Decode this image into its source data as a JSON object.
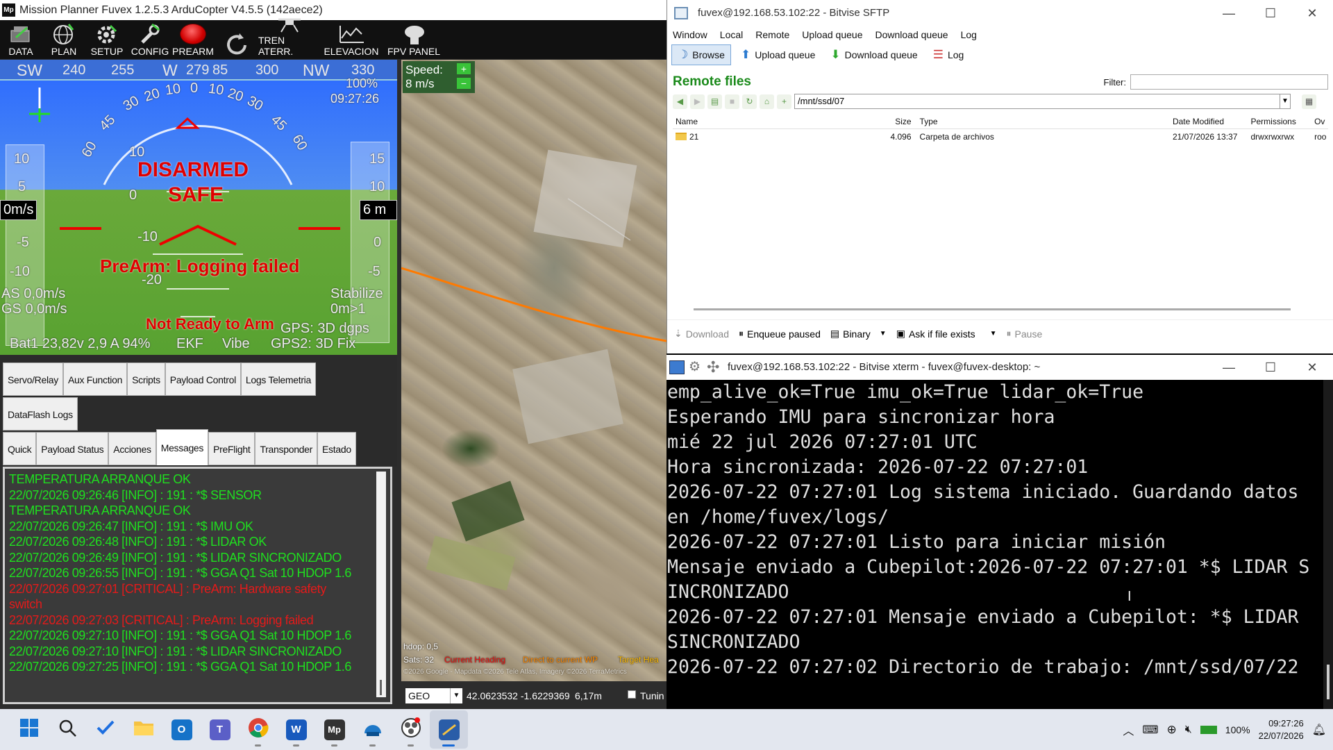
{
  "mp": {
    "title": "Mission Planner Fuvex 1.2.5.3 ArduCopter V4.5.5 (142aece2)",
    "app_icon_text": "Mp",
    "toolbar": [
      {
        "label": "DATA",
        "icon": "data-icon"
      },
      {
        "label": "PLAN",
        "icon": "globe-icon"
      },
      {
        "label": "SETUP",
        "icon": "gear-icon"
      },
      {
        "label": "CONFIG",
        "icon": "wrench-icon"
      },
      {
        "label": "PREARM",
        "icon": "red-button-icon"
      },
      {
        "label": "",
        "icon": "refresh-icon"
      },
      {
        "label": "TREN ATERR.",
        "icon": "drone-icon"
      },
      {
        "label": "ELEVACION",
        "icon": "chart-icon"
      },
      {
        "label": "FPV PANEL",
        "icon": "fpv-icon"
      }
    ],
    "hud": {
      "compass": [
        "SW",
        "240",
        "255",
        "W",
        "279",
        "85",
        "300",
        "NW",
        "330"
      ],
      "pitch_labels": [
        "10",
        "0",
        "-10",
        "-20"
      ],
      "roll_labels": [
        "30",
        "20",
        "10",
        "0",
        "10",
        "20",
        "30",
        "45",
        "45",
        "60",
        "60"
      ],
      "disarmed": "DISARMED",
      "safe": "SAFE",
      "prearm_msg": "PreArm: Logging failed",
      "not_ready": "Not Ready to Arm",
      "gps1": "GPS: 3D dgps",
      "gps2": "GPS2: 3D Fix",
      "airspeed": "AS 0,0m/s",
      "groundspeed": "GS 0,0m/s",
      "speed_box": "0m/s",
      "alt_box": "6 m",
      "mode": "Stabilize",
      "wp": "0m>1",
      "battery": "Bat1 23,82v 2,9 A 94%",
      "ekf": "EKF",
      "vibe": "Vibe",
      "link": "100%",
      "time": "09:27:26",
      "speed_scale": [
        "10",
        "5",
        "-5",
        "-10"
      ],
      "alt_scale": [
        "15",
        "10",
        "0",
        "-5"
      ],
      "colors": {
        "sky": "#2a68ff",
        "ground": "#58a231",
        "warning": "#e00000"
      }
    },
    "tabs_row1": [
      "Servo/Relay",
      "Aux Function",
      "Scripts",
      "Payload Control",
      "Logs Telemetria"
    ],
    "tabs_row2": [
      "DataFlash Logs"
    ],
    "tabs_row3": [
      "Quick",
      "Payload Status",
      "Acciones",
      "Messages",
      "PreFlight",
      "Transponder",
      "Estado"
    ],
    "active_tab": "Messages",
    "messages": [
      {
        "text": "TEMPERATURA ARRANQUE OK",
        "level": "ok"
      },
      {
        "text": "22/07/2026 09:26:46 [INFO] : 191 : *$ SENSOR",
        "level": "ok"
      },
      {
        "text": "TEMPERATURA ARRANQUE OK",
        "level": "ok"
      },
      {
        "text": "22/07/2026 09:26:47 [INFO] : 191 : *$ IMU OK",
        "level": "ok"
      },
      {
        "text": "22/07/2026 09:26:48 [INFO] : 191 : *$ LIDAR OK",
        "level": "ok"
      },
      {
        "text": "22/07/2026 09:26:49 [INFO] : 191 : *$ LIDAR SINCRONIZADO",
        "level": "ok"
      },
      {
        "text": "22/07/2026 09:26:55 [INFO] : 191 : *$ GGA Q1 Sat 10 HDOP 1.6",
        "level": "ok"
      },
      {
        "text": "22/07/2026 09:27:01 [CRITICAL] : PreArm: Hardware safety",
        "level": "err"
      },
      {
        "text": "switch",
        "level": "err"
      },
      {
        "text": "22/07/2026 09:27:03 [CRITICAL] : PreArm: Logging failed",
        "level": "err"
      },
      {
        "text": "22/07/2026 09:27:10 [INFO] : 191 : *$ GGA Q1 Sat 10 HDOP 1.6",
        "level": "ok"
      },
      {
        "text": "22/07/2026 09:27:10 [INFO] : 191 : *$ LIDAR SINCRONIZADO",
        "level": "ok"
      },
      {
        "text": "22/07/2026 09:27:25 [INFO] : 191 : *$ GGA Q1 Sat 10 HDOP 1.6",
        "level": "ok"
      }
    ],
    "map": {
      "speed_label": "Speed:",
      "speed_value": "8 m/s",
      "hdop": "hdop: 0,5",
      "sats": "Sats: 32",
      "legend_current_heading": "Current Heading",
      "legend_direct_wp": "Direct to current WP",
      "legend_target": "Target Hea",
      "copyright": "©2026 Google - Mapdata ©2026 Tele Atlas, Imagery ©2026 TerraMetrics",
      "coord_mode": "GEO",
      "coords": "42.0623532 -1.6229369",
      "alt": "6,17m",
      "tuning_label": "Tunin"
    }
  },
  "sftp": {
    "title": "fuvex@192.168.53.102:22 - Bitvise SFTP",
    "menu": [
      "Window",
      "Local",
      "Remote",
      "Upload queue",
      "Download queue",
      "Log"
    ],
    "toolbar": [
      {
        "label": "Browse",
        "icon": "browse-icon"
      },
      {
        "label": "Upload queue",
        "icon": "upload-icon"
      },
      {
        "label": "Download queue",
        "icon": "download-icon"
      },
      {
        "label": "Log",
        "icon": "log-icon"
      }
    ],
    "remote_title": "Remote files",
    "filter_label": "Filter:",
    "filter_value": "",
    "path": "/mnt/ssd/07",
    "columns": [
      "Name",
      "Size",
      "Type",
      "Date Modified",
      "Permissions",
      "Ov"
    ],
    "files": [
      {
        "name": "21",
        "size": "4.096",
        "type": "Carpeta de archivos",
        "date": "21/07/2026 13:37",
        "perm": "drwxrwxrwx",
        "owner": "roo"
      }
    ],
    "bottom": {
      "download": "Download",
      "enqueue": "Enqueue paused",
      "binary": "Binary",
      "ask": "Ask if file exists",
      "pause": "Pause"
    }
  },
  "xterm": {
    "title": "fuvex@192.168.53.102:22 - Bitvise xterm - fuvex@fuvex-desktop: ~",
    "lines": [
      "emp_alive_ok=True imu_ok=True lidar_ok=True",
      "Esperando IMU para sincronizar hora",
      "mié 22 jul 2026 07:27:01 UTC",
      "Hora sincronizada: 2026-07-22 07:27:01",
      "2026-07-22 07:27:01 Log sistema iniciado. Guardando datos",
      "en /home/fuvex/logs/",
      "2026-07-22 07:27:01 Listo para iniciar misión",
      "Mensaje enviado a Cubepilot:2026-07-22 07:27:01 *$ LIDAR S",
      "INCRONIZADO",
      "2026-07-22 07:27:01 Mensaje enviado a Cubepilot: *$ LIDAR",
      "SINCRONIZADO",
      "2026-07-22 07:27:02 Directorio de trabajo: /mnt/ssd/07/22"
    ]
  },
  "taskbar": {
    "apps": [
      {
        "name": "start",
        "icon": "windows-icon"
      },
      {
        "name": "search",
        "icon": "search-icon"
      },
      {
        "name": "todo",
        "icon": "checkmark-icon"
      },
      {
        "name": "explorer",
        "icon": "folder-icon"
      },
      {
        "name": "outlook",
        "icon": "outlook-icon"
      },
      {
        "name": "teams",
        "icon": "teams-icon"
      },
      {
        "name": "chrome",
        "icon": "chrome-icon"
      },
      {
        "name": "word",
        "icon": "word-icon"
      },
      {
        "name": "missionplanner",
        "icon": "mp-icon",
        "label": "Mp"
      },
      {
        "name": "bitvise",
        "icon": "bitvise-icon"
      },
      {
        "name": "obs",
        "icon": "obs-icon"
      },
      {
        "name": "terminal",
        "icon": "terminal-icon"
      }
    ],
    "battery": "100%",
    "time": "09:27:26",
    "date": "22/07/2026"
  }
}
